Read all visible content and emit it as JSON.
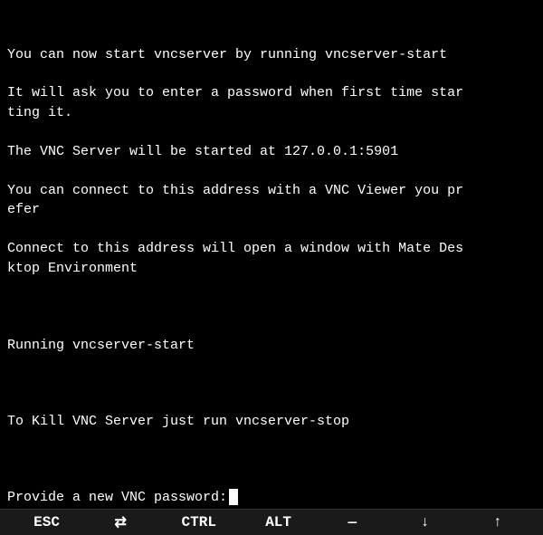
{
  "terminal": {
    "lines": [
      "You can now start vncserver by running vncserver-start",
      "",
      "It will ask you to enter a password when first time star",
      "ting it.",
      "",
      "The VNC Server will be started at 127.0.0.1:5901",
      "",
      "You can connect to this address with a VNC Viewer you pr",
      "efer",
      "",
      "Connect to this address will open a window with Mate Des",
      "ktop Environment",
      "",
      "",
      "",
      "Running vncserver-start",
      "",
      "",
      "",
      "To Kill VNC Server just run vncserver-stop",
      "",
      "",
      ""
    ],
    "password_prompt": "Provide a new VNC password: "
  },
  "toolbar": {
    "buttons": [
      {
        "label": "ESC",
        "id": "esc"
      },
      {
        "label": "⇄",
        "id": "tab"
      },
      {
        "label": "CTRL",
        "id": "ctrl"
      },
      {
        "label": "ALT",
        "id": "alt"
      },
      {
        "label": "—",
        "id": "dash"
      },
      {
        "label": "↓",
        "id": "down"
      },
      {
        "label": "↑",
        "id": "up"
      }
    ]
  }
}
